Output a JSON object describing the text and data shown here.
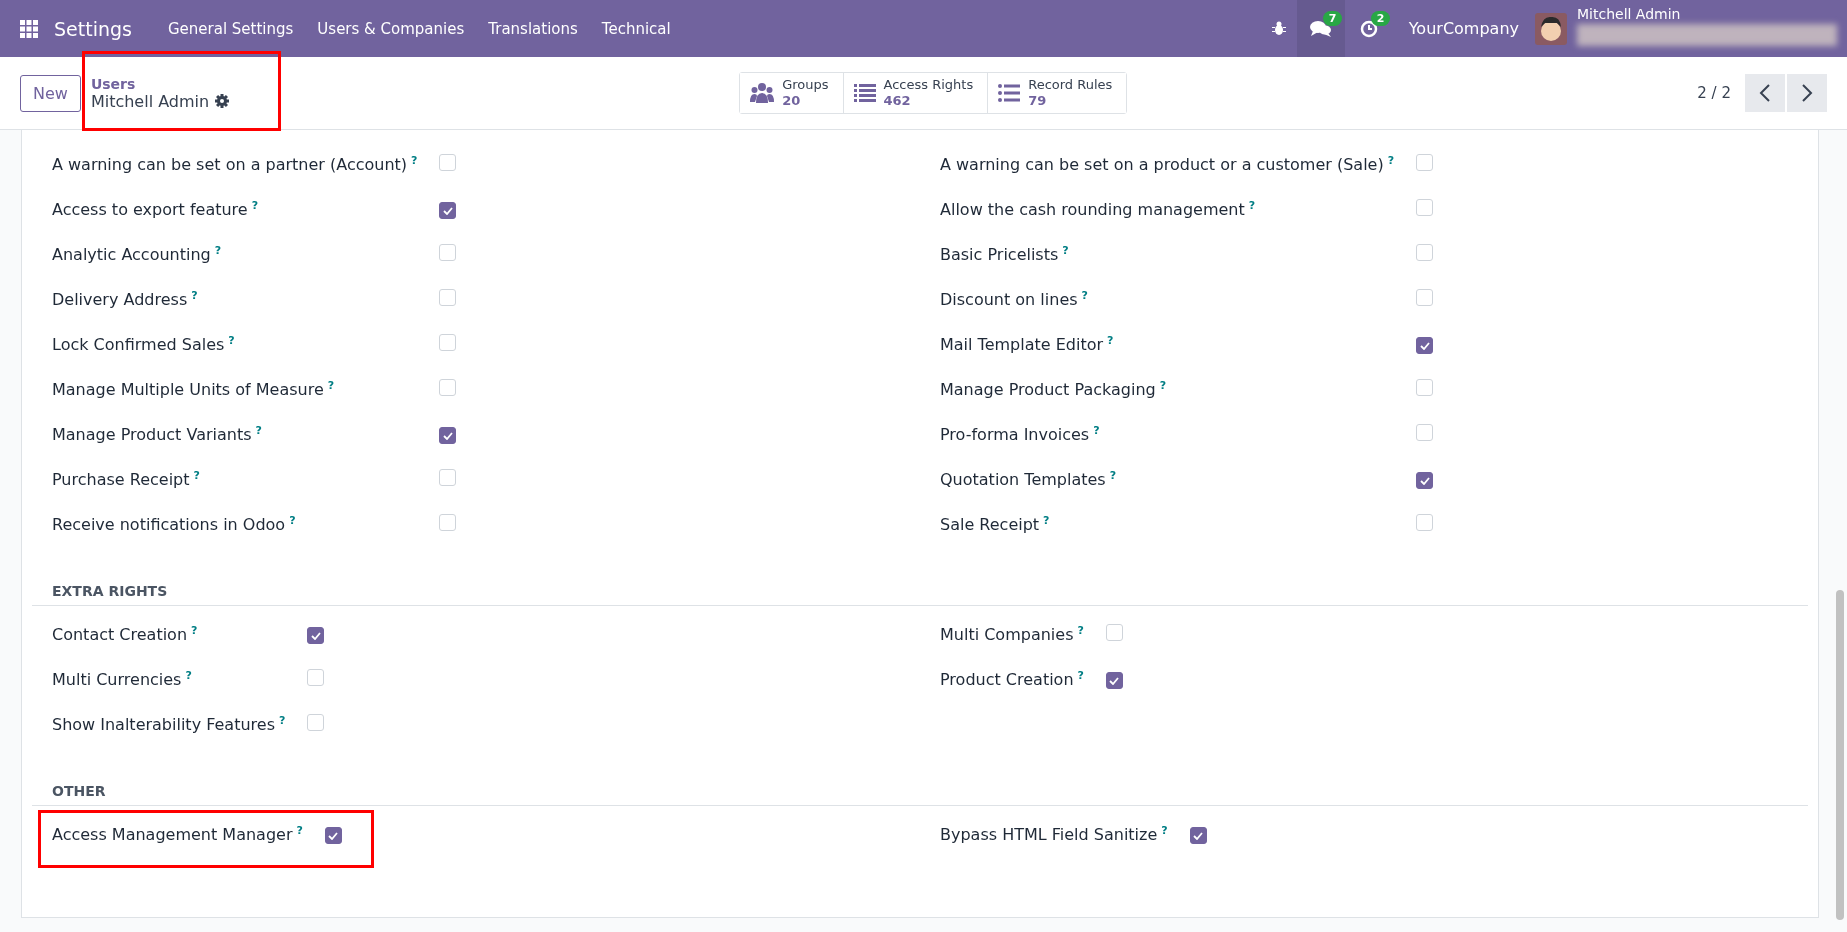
{
  "navbar": {
    "app_title": "Settings",
    "menu": [
      "General Settings",
      "Users & Companies",
      "Translations",
      "Technical"
    ],
    "messages_count": "7",
    "activities_count": "2",
    "company": "YourCompany",
    "user": {
      "name": "Mitchell Admin",
      "detail_redacted": true
    }
  },
  "control_panel": {
    "new_button": "New",
    "breadcrumb": {
      "parent": "Users",
      "current": "Mitchell Admin",
      "highlighted": true
    },
    "stat_buttons": [
      {
        "kind": "groups",
        "label": "Groups",
        "value": "20"
      },
      {
        "kind": "list",
        "label": "Access Rights",
        "value": "462"
      },
      {
        "kind": "bullets",
        "label": "Record Rules",
        "value": "79"
      }
    ],
    "pager": "2 / 2"
  },
  "sections": [
    {
      "columns": [
        [
          {
            "label": "A warning can be set on a partner (Account)",
            "help": "?",
            "checked": false
          },
          {
            "label": "Access to export feature",
            "help": "?",
            "checked": true
          },
          {
            "label": "Analytic Accounting",
            "help": "?",
            "checked": false
          },
          {
            "label": "Delivery Address",
            "help": "?",
            "checked": false
          },
          {
            "label": "Lock Confirmed Sales",
            "help": "?",
            "checked": false
          },
          {
            "label": "Manage Multiple Units of Measure",
            "help": "?",
            "checked": false
          },
          {
            "label": "Manage Product Variants",
            "help": "?",
            "checked": true
          },
          {
            "label": "Purchase Receipt",
            "help": "?",
            "checked": false
          },
          {
            "label": "Receive notifications in Odoo",
            "help": "?",
            "checked": false
          }
        ],
        [
          {
            "label": "A warning can be set on a product or a customer (Sale)",
            "help": "?",
            "checked": false
          },
          {
            "label": "Allow the cash rounding management",
            "help": "?",
            "checked": false
          },
          {
            "label": "Basic Pricelists",
            "help": "?",
            "checked": false
          },
          {
            "label": "Discount on lines",
            "help": "?",
            "checked": false
          },
          {
            "label": "Mail Template Editor",
            "help": "?",
            "checked": true
          },
          {
            "label": "Manage Product Packaging",
            "help": "?",
            "checked": false
          },
          {
            "label": "Pro-forma Invoices",
            "help": "?",
            "checked": false
          },
          {
            "label": "Quotation Templates",
            "help": "?",
            "checked": true
          },
          {
            "label": "Sale Receipt",
            "help": "?",
            "checked": false
          }
        ]
      ]
    },
    {
      "title": "EXTRA RIGHTS",
      "columns": [
        [
          {
            "label": "Contact Creation",
            "help": "?",
            "checked": true
          },
          {
            "label": "Multi Currencies",
            "help": "?",
            "checked": false
          },
          {
            "label": "Show Inalterability Features",
            "help": "?",
            "checked": false
          }
        ],
        [
          {
            "label": "Multi Companies",
            "help": "?",
            "checked": false
          },
          {
            "label": "Product Creation",
            "help": "?",
            "checked": true
          }
        ]
      ]
    },
    {
      "title": "OTHER",
      "columns": [
        [
          {
            "label": "Access Management Manager",
            "help": "?",
            "checked": true,
            "highlighted": true
          }
        ],
        [
          {
            "label": "Bypass HTML Field Sanitize",
            "help": "?",
            "checked": true
          }
        ]
      ]
    }
  ]
}
